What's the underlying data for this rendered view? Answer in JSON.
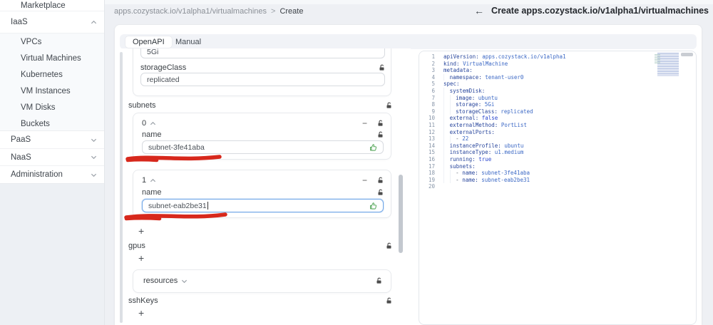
{
  "colors": {
    "annotation_red": "#d7281c",
    "focus_blue": "#74a9e8",
    "thumb_green": "#58a85c",
    "editor_key": "#27459c",
    "editor_value": "#3b68c5",
    "editor_bool": "#2a46cf"
  },
  "sidebar": {
    "items": [
      {
        "label": "Marketplace"
      },
      {
        "label": "IaaS",
        "state": "expanded"
      },
      {
        "label": "VPCs"
      },
      {
        "label": "Virtual Machines"
      },
      {
        "label": "Kubernetes"
      },
      {
        "label": "VM Instances"
      },
      {
        "label": "VM Disks"
      },
      {
        "label": "Buckets"
      },
      {
        "label": "PaaS",
        "state": "collapsed"
      },
      {
        "label": "NaaS",
        "state": "collapsed"
      },
      {
        "label": "Administration",
        "state": "collapsed"
      }
    ]
  },
  "breadcrumb": {
    "path": "apps.cozystack.io/v1alpha1/virtualmachines",
    "separator": ">",
    "current": "Create"
  },
  "header": {
    "back_arrow": "←",
    "title": "Create apps.cozystack.io/v1alpha1/virtualmachines"
  },
  "tabs": {
    "openapi": "OpenAPI",
    "manual": "Manual"
  },
  "form": {
    "top_partial_value": "5Gi",
    "storageClass": {
      "label": "storageClass",
      "value": "replicated"
    },
    "subnets": {
      "label": "subnets",
      "item0": {
        "index": "0",
        "field_label": "name",
        "value": "subnet-3fe41aba"
      },
      "item1": {
        "index": "1",
        "field_label": "name",
        "value": "subnet-eab2be31"
      },
      "add": "+",
      "remove": "−"
    },
    "gpus": {
      "label": "gpus",
      "add": "+"
    },
    "resources": {
      "label": "resources"
    },
    "sshKeys": {
      "label": "sshKeys",
      "add": "+"
    }
  },
  "editor": {
    "lines": [
      {
        "n": 1,
        "indent": 0,
        "key": "apiVersion",
        "value": "apps.cozystack.io/v1alpha1",
        "vt": "str"
      },
      {
        "n": 2,
        "indent": 0,
        "key": "kind",
        "value": "VirtualMachine",
        "vt": "str"
      },
      {
        "n": 3,
        "indent": 0,
        "key": "metadata"
      },
      {
        "n": 4,
        "indent": 1,
        "key": "namespace",
        "value": "tenant-user0",
        "vt": "str"
      },
      {
        "n": 5,
        "indent": 0,
        "key": "spec"
      },
      {
        "n": 6,
        "indent": 1,
        "key": "systemDisk"
      },
      {
        "n": 7,
        "indent": 2,
        "key": "image",
        "value": "ubuntu",
        "vt": "str"
      },
      {
        "n": 8,
        "indent": 2,
        "key": "storage",
        "value": "5Gi",
        "vt": "str"
      },
      {
        "n": 9,
        "indent": 2,
        "key": "storageClass",
        "value": "replicated",
        "vt": "str"
      },
      {
        "n": 10,
        "indent": 1,
        "key": "external",
        "value": "false",
        "vt": "bool"
      },
      {
        "n": 11,
        "indent": 1,
        "key": "externalMethod",
        "value": "PortList",
        "vt": "str"
      },
      {
        "n": 12,
        "indent": 1,
        "key": "externalPorts"
      },
      {
        "n": 13,
        "indent": 2,
        "dash": true,
        "value": "22",
        "vt": "num"
      },
      {
        "n": 14,
        "indent": 1,
        "key": "instanceProfile",
        "value": "ubuntu",
        "vt": "str"
      },
      {
        "n": 15,
        "indent": 1,
        "key": "instanceType",
        "value": "u1.medium",
        "vt": "str"
      },
      {
        "n": 16,
        "indent": 1,
        "key": "running",
        "value": "true",
        "vt": "bool"
      },
      {
        "n": 17,
        "indent": 1,
        "key": "subnets"
      },
      {
        "n": 18,
        "indent": 2,
        "dash": true,
        "key": "name",
        "value": "subnet-3fe41aba",
        "vt": "str"
      },
      {
        "n": 19,
        "indent": 2,
        "dash": true,
        "key": "name",
        "value": "subnet-eab2be31",
        "vt": "str"
      },
      {
        "n": 20,
        "indent": 0
      }
    ]
  }
}
